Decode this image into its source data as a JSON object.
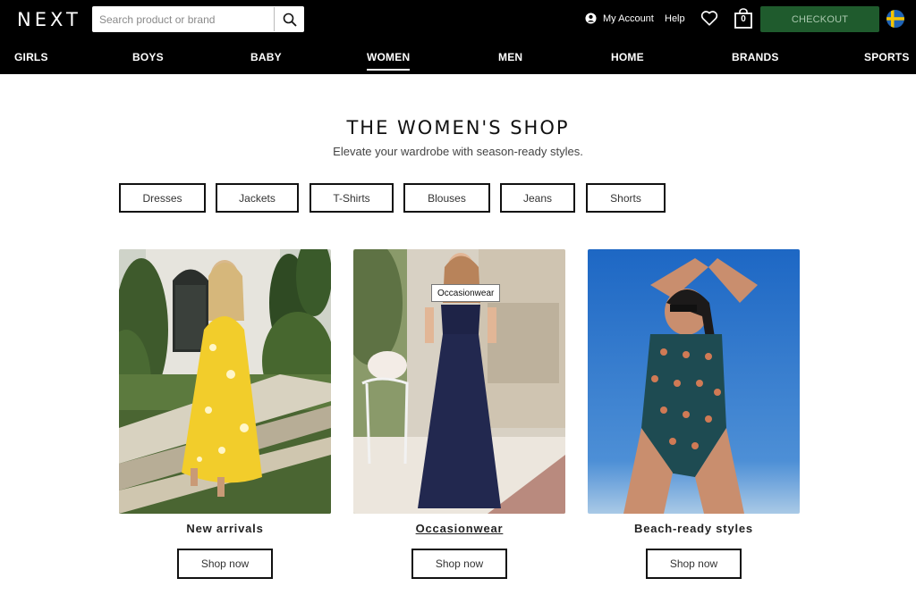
{
  "header": {
    "logo": "NEXT",
    "search_placeholder": "Search product or brand",
    "my_account": "My Account",
    "help": "Help",
    "bag_count": "0",
    "checkout": "CHECKOUT"
  },
  "nav": [
    {
      "label": "GIRLS"
    },
    {
      "label": "BOYS"
    },
    {
      "label": "BABY"
    },
    {
      "label": "WOMEN"
    },
    {
      "label": "MEN"
    },
    {
      "label": "HOME"
    },
    {
      "label": "BRANDS"
    },
    {
      "label": "SPORTS"
    }
  ],
  "main": {
    "title": "THE WOMEN'S SHOP",
    "subtitle": "Elevate your wardrobe with season-ready styles.",
    "chips": [
      "Dresses",
      "Jackets",
      "T-Shirts",
      "Blouses",
      "Jeans",
      "Shorts"
    ],
    "cards": [
      {
        "label": "New arrivals",
        "button": "Shop now"
      },
      {
        "label": "Occasionwear",
        "button": "Shop now",
        "tooltip": "Occasionwear"
      },
      {
        "label": "Beach-ready styles",
        "button": "Shop now"
      }
    ]
  },
  "colors": {
    "header_bg": "#000000",
    "checkout_bg": "#1f5b2d",
    "text": "#111111"
  }
}
